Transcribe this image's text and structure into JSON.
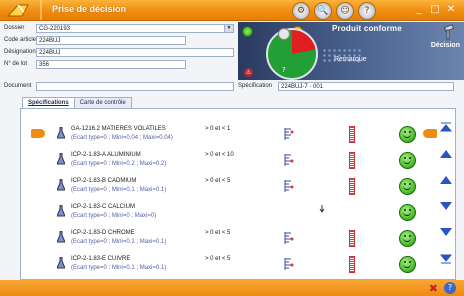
{
  "window": {
    "title": "Prise de décision",
    "controls": {
      "minimize": "_",
      "restore": "□",
      "close": "✕"
    }
  },
  "form": {
    "dossier": {
      "label": "Dossier",
      "value": "CG-220193"
    },
    "code_article": {
      "label": "Code article",
      "value": "224BUJ"
    },
    "designation": {
      "label": "Désignation",
      "value": "224BUJ"
    },
    "lot": {
      "label": "N° de lot",
      "value": "356"
    },
    "document": {
      "label": "Document",
      "value": ""
    },
    "specification": {
      "label": "Spécification",
      "value": "224BUJ-7 · 001"
    }
  },
  "header": {
    "product_status": "Produit conforme",
    "remarque": "Remarque",
    "decision": "Décision",
    "question": "?"
  },
  "tabs": [
    {
      "label": "Spécifications",
      "active": true
    },
    {
      "label": "Carte de contrôle",
      "active": false
    }
  ],
  "rows": [
    {
      "name": "GA-1216.2 MATIERES VOLATILES",
      "detail": "(Ecart type=0 ; Mini=0.04 ; Maxi=0.04)",
      "condition": "> 0 et < 1",
      "selected": true,
      "gauge": true
    },
    {
      "name": "ICP-2-1.83-A ALUMINIUM",
      "detail": "(Ecart type=0 ; Mini=0.2 ; Maxi=0.2)",
      "condition": "> 0 et < 10",
      "selected": false,
      "gauge": true
    },
    {
      "name": "ICP-2-1.83-B CADMIUM",
      "detail": "(Ecart type=0 ; Mini=0.1 ; Maxi=0.1)",
      "condition": "> 0 et < 5",
      "selected": false,
      "gauge": true
    },
    {
      "name": "ICP-2-1.83-C CALCIUM",
      "detail": "(Ecart type=0 ; Mini=0 ; Maxi=0)",
      "condition": "",
      "selected": false,
      "gauge": false
    },
    {
      "name": "ICP-2-1.83-D CHROME",
      "detail": "(Ecart type=0 ; Mini=0.1 ; Maxi=0.1)",
      "condition": "> 0 et < 5",
      "selected": false,
      "gauge": true
    },
    {
      "name": "ICP-2-1.83-E CUIVRE",
      "detail": "(Ecart type=0 ; Mini=0.1 ; Maxi=0.1)",
      "condition": "> 0 et < 5",
      "selected": false,
      "gauge": true
    }
  ],
  "colors": {
    "accent": "#f08c10",
    "ok": "#4bbb2c",
    "fail": "#e02020"
  },
  "status": {
    "pie_fail_fraction": 0.22
  }
}
